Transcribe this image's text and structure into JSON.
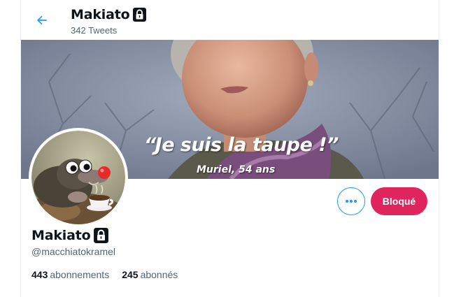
{
  "header": {
    "name": "Makiato",
    "tweet_count": "342 Tweets"
  },
  "banner": {
    "quote": "“Je suis la taupe !”",
    "caption": "Muriel, 54 ans"
  },
  "profile": {
    "name": "Makiato",
    "handle": "@macchiatokramel",
    "following_count": "443",
    "following_label": "abonnements",
    "followers_count": "245",
    "followers_label": "abonnés"
  },
  "actions": {
    "blocked_label": "Bloqué"
  },
  "icons": {
    "back": "arrow-left-icon",
    "lock": "lock-icon",
    "more": "more-horizontal-icon"
  },
  "colors": {
    "accent": "#1d9bf0",
    "blocked": "#e0245e",
    "secondary_text": "#536471"
  }
}
